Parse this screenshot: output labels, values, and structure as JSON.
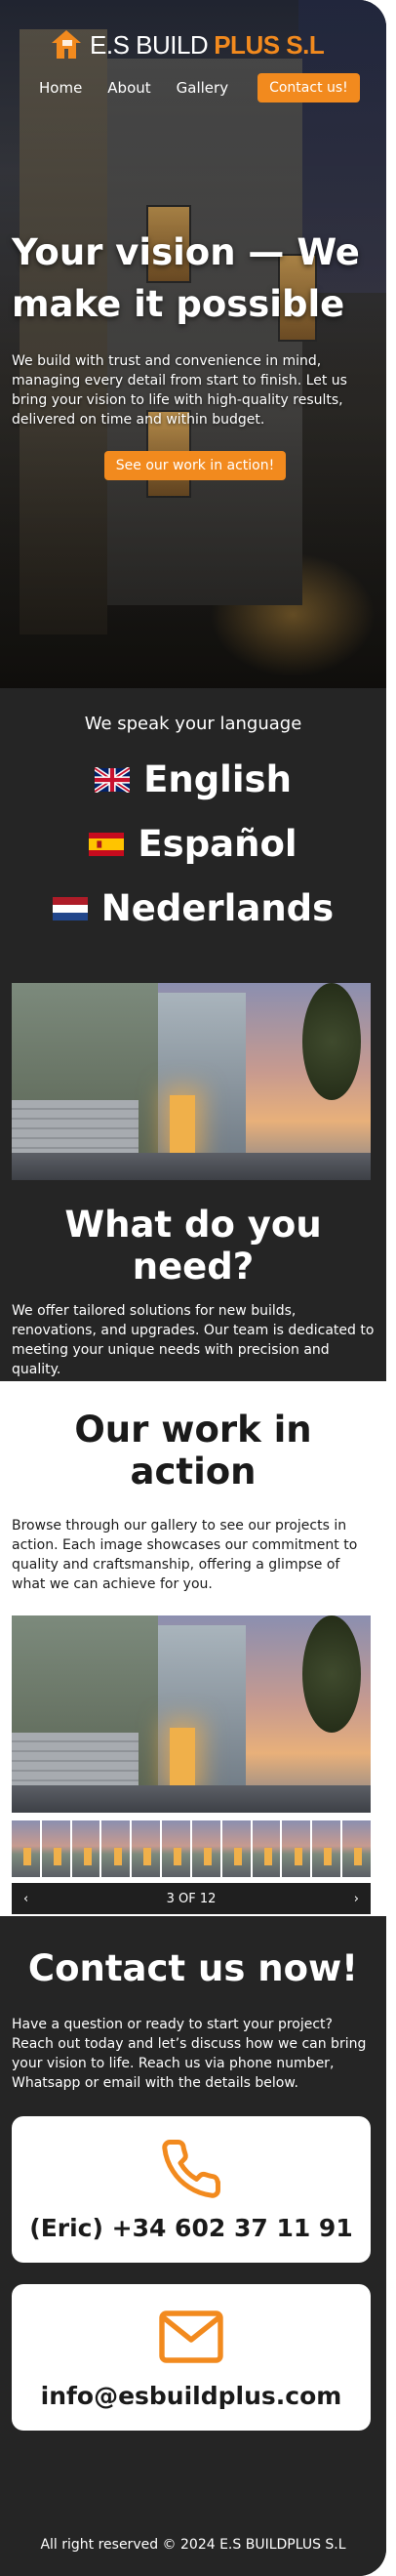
{
  "brand": {
    "name_white": "E.S BUILD",
    "name_orange": "PLUS S.L",
    "accent": "#f28a1e"
  },
  "nav": {
    "items": [
      "Home",
      "About",
      "Gallery"
    ],
    "cta": "Contact us!"
  },
  "hero": {
    "title": "Your vision — We make it possible",
    "body": "We build with trust and convenience in mind, managing every detail from start to finish. Let us bring your vision to life with high-quality results, delivered on time and within budget.",
    "button": "See our work in action!"
  },
  "languages": {
    "kicker": "We speak your language",
    "items": [
      {
        "label": "English",
        "flag": "uk-flag-icon"
      },
      {
        "label": "Español",
        "flag": "spain-flag-icon"
      },
      {
        "label": "Nederlands",
        "flag": "netherlands-flag-icon"
      }
    ]
  },
  "need": {
    "title": "What do you need?",
    "body": "We offer tailored solutions for new builds, renovations, and upgrades. Our team is dedicated to meeting your unique needs with precision and quality."
  },
  "work": {
    "title": "Our work in action",
    "body": "Browse through our gallery to see our projects in action. Each image showcases our commitment to quality and craftsmanship, offering a glimpse of what we can achieve for you.",
    "pager": "3 OF 12",
    "thumb_count": 12
  },
  "contact": {
    "title": "Contact us now!",
    "body": "Have a question or ready to start your project? Reach out today and let’s discuss how we can bring your vision to life. Reach us via phone number, Whatsapp or email with the details below.",
    "phone": "(Eric) +34 602 37 11 91",
    "email": "info@esbuildplus.com"
  },
  "footer": {
    "text": "All right reserved © 2024 E.S BUILDPLUS S.L"
  }
}
